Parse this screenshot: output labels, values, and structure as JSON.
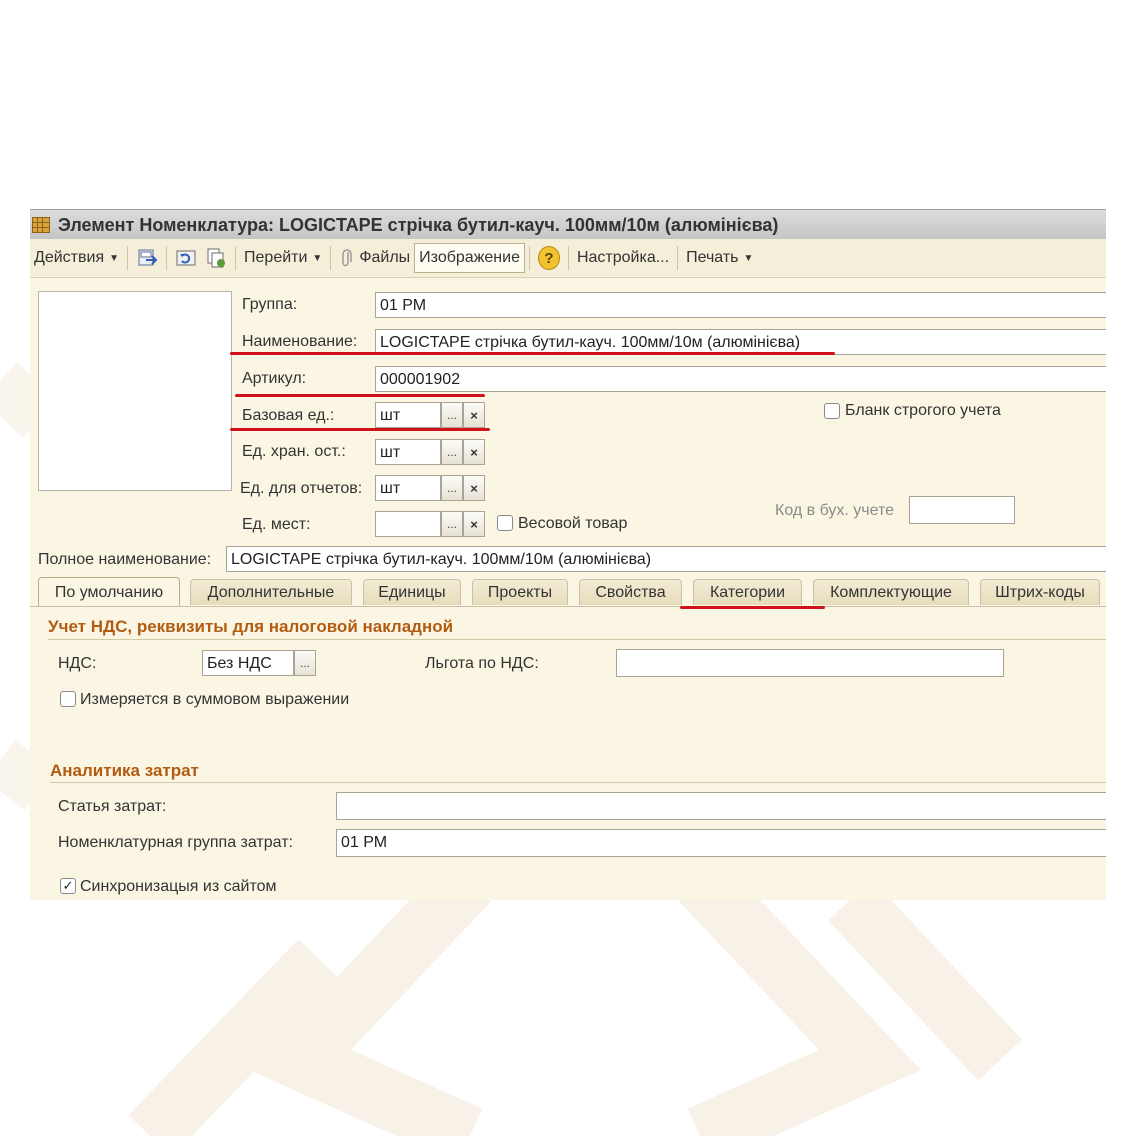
{
  "window": {
    "title": "Элемент Номенклатура: LOGICTAPE стрічка бутил-кауч. 100мм/10м (алюмінієва)"
  },
  "toolbar": {
    "actions": "Действия",
    "goto": "Перейти",
    "files": "Файлы",
    "image": "Изображение",
    "settings": "Настройка...",
    "print": "Печать",
    "icons": [
      "save-close-icon",
      "refresh-icon",
      "copy-icon",
      "paperclip-icon",
      "help-icon"
    ]
  },
  "form": {
    "group_label": "Группа:",
    "group_value": "01 РМ",
    "name_label": "Наименование:",
    "name_value": "LOGICTAPE стрічка бутил-кауч. 100мм/10м (алюмінієва)",
    "article_label": "Артикул:",
    "article_value": "000001902",
    "base_unit_label": "Базовая ед.:",
    "base_unit_value": "шт",
    "storage_unit_label": "Ед. хран. ост.:",
    "storage_unit_value": "шт",
    "report_unit_label": "Ед. для отчетов:",
    "report_unit_value": "шт",
    "place_unit_label": "Ед. мест:",
    "place_unit_value": "",
    "weight_item_label": "Весовой товар",
    "strict_form_label": "Бланк строгого учета",
    "accounting_code_label": "Код в бух. учете",
    "accounting_code_value": "",
    "full_name_label": "Полное наименование:",
    "full_name_value": "LOGICTAPE стрічка бутил-кауч. 100мм/10м (алюмінієва)",
    "select_glyph": "...",
    "clear_glyph": "×"
  },
  "tabs": [
    {
      "label": "По умолчанию",
      "active": true
    },
    {
      "label": "Дополнительные"
    },
    {
      "label": "Единицы"
    },
    {
      "label": "Проекты"
    },
    {
      "label": "Свойства"
    },
    {
      "label": "Категории",
      "highlighted": true
    },
    {
      "label": "Комплектующие"
    },
    {
      "label": "Штрих-коды"
    }
  ],
  "vat_section": {
    "title": "Учет НДС, реквизиты для налоговой накладной",
    "vat_label": "НДС:",
    "vat_value": "Без НДС",
    "vat_benefit_label": "Льгота по НДС:",
    "vat_benefit_value": "",
    "sum_measure_label": "Измеряется в суммовом выражении",
    "sum_measure_checked": false
  },
  "cost_section": {
    "title": "Аналитика затрат",
    "cost_item_label": "Статья затрат:",
    "cost_item_value": "",
    "cost_group_label": "Номенклатурная группа затрат:",
    "cost_group_value": "01 РМ",
    "sync_label": "Синхронизацыя из сайтом",
    "sync_checked": true,
    "check_glyph": "✓"
  },
  "colors": {
    "accent_underline": "#d0121b",
    "section_title": "#b25c12",
    "form_background": "#fbf6e4"
  }
}
